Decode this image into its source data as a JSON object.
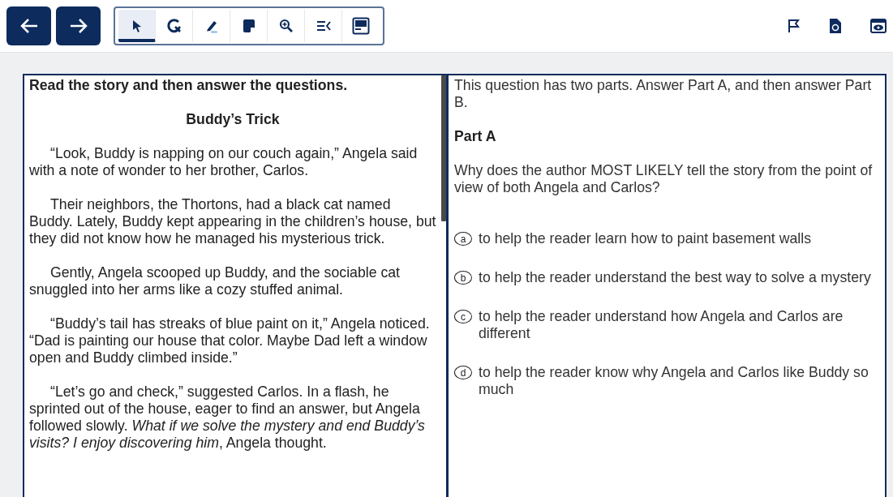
{
  "nav_buttons": [
    {
      "kind": "back"
    },
    {
      "kind": "forward"
    }
  ],
  "tools": [
    {
      "kind": "pointer",
      "selected": true
    },
    {
      "kind": "rubber",
      "selected": false
    },
    {
      "kind": "highlighter",
      "selected": false
    },
    {
      "kind": "note",
      "selected": false
    },
    {
      "kind": "zoom",
      "selected": false
    },
    {
      "kind": "line-reader",
      "selected": false
    },
    {
      "kind": "mask",
      "selected": false
    }
  ],
  "right_tools": [
    {
      "kind": "flag"
    },
    {
      "kind": "document"
    },
    {
      "kind": "eye"
    }
  ],
  "passage": {
    "instruction": "Read the story and then answer the questions.",
    "title": "Buddy’s Trick",
    "paragraphs": [
      "“Look, Buddy is napping on our couch again,” Angela said with a note of wonder to her brother, Carlos.",
      "Their neighbors, the Thortons, had a black cat named Buddy. Lately, Buddy kept appearing in the children’s house, but they did not know how he managed his mysterious trick.",
      "Gently, Angela scooped up Buddy, and the sociable cat snuggled into her arms like a cozy stuffed animal.",
      "“Buddy’s tail has streaks of blue paint on it,” Angela noticed. “Dad is painting our house that color. Maybe Dad left a window open and Buddy climbed inside.”",
      "“Let’s go and check,” suggested Carlos. In a flash, he sprinted out of the house, eager to find an answer, but Angela followed slowly. *What if we solve the mystery and end Buddy’s visits? I enjoy discovering him*, Angela thought."
    ]
  },
  "question": {
    "intro": "This question has two parts. Answer Part A, and then answer Part B.",
    "part": "Part A",
    "prompt": "Why does the author MOST LIKELY tell the story from the point of view of both Angela and Carlos?",
    "options": [
      {
        "letter": "a",
        "text": "to help the reader learn how to paint basement walls",
        "selected": false
      },
      {
        "letter": "b",
        "text": "to help the reader understand the best way to solve a mystery",
        "selected": false
      },
      {
        "letter": "c",
        "text": "to help the reader understand how Angela and Carlos are different",
        "selected": false
      },
      {
        "letter": "d",
        "text": "to help the reader know why Angela and Carlos like Buddy so much",
        "selected": false
      }
    ]
  }
}
